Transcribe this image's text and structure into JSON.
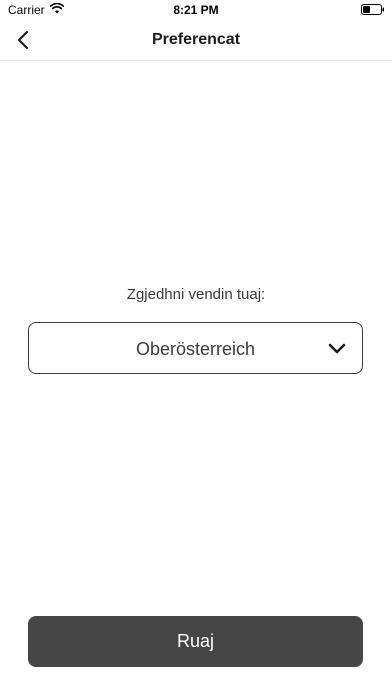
{
  "status_bar": {
    "carrier": "Carrier",
    "time": "8:21 PM",
    "wifi_icon": "wifi-icon",
    "battery_icon": "battery-icon"
  },
  "nav": {
    "title": "Preferencat",
    "back_icon": "chevron-left-icon"
  },
  "content": {
    "country_label": "Zgjedhni vendin tuaj:",
    "country_select": {
      "value": "Oberösterreich",
      "icon": "chevron-down-icon"
    }
  },
  "footer": {
    "save_label": "Ruaj"
  },
  "colors": {
    "button_bg": "#464646",
    "button_text": "#ffffff",
    "border": "#3a3a3c",
    "divider": "#e6e6e6"
  }
}
